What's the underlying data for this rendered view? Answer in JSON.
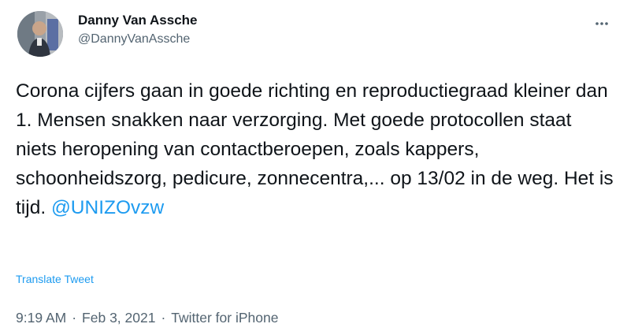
{
  "author": {
    "display_name": "Danny Van Assche",
    "handle": "@DannyVanAssche",
    "avatar_icon": "profile-photo"
  },
  "header": {
    "more_icon": "more-horizontal-icon"
  },
  "tweet": {
    "text": "Corona cijfers gaan in goede richting en reproductiegraad kleiner dan 1. Mensen snakken naar verzorging. Met goede protocollen staat niets heropening van contactberoepen, zoals kappers, schoonheidszorg, pedicure, zonnecentra,... op 13/02 in de weg. Het is tijd. ",
    "mention": "@UNIZOvzw"
  },
  "translate_label": "Translate Tweet",
  "meta": {
    "time": "9:19 AM",
    "date": "Feb 3, 2021",
    "source": "Twitter for iPhone",
    "separator": "·"
  },
  "colors": {
    "link": "#1d9bf0",
    "text": "#0f1419",
    "secondary": "#536471"
  }
}
